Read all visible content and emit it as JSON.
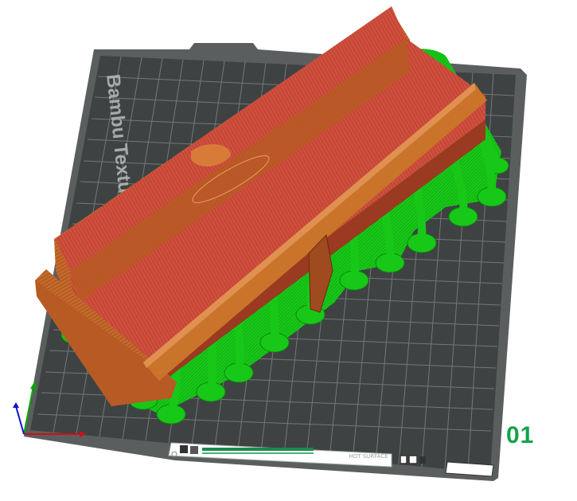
{
  "viewport": {
    "bed_label": "Bambu Textured",
    "plate_number": "01",
    "plate_name": "HOT SURFACE",
    "colors": {
      "bed_outer": "#5a5e5f",
      "bed_inner": "#3f4243",
      "grid_line": "#8a8e8e",
      "model_body": "#b85a24",
      "model_top": "#c9742a",
      "model_red": "#c8463a",
      "support_green": "#18c818",
      "plate_number": "#13a34a",
      "axis_x": "#d01010",
      "axis_y": "#10a010",
      "axis_z": "#1010d0"
    },
    "plate_toolbar": {
      "icons": [
        "plate-slice-icon",
        "plate-select-icon",
        "plate-arrange-icon",
        "plate-orient-icon",
        "plate-lock-icon"
      ]
    }
  }
}
